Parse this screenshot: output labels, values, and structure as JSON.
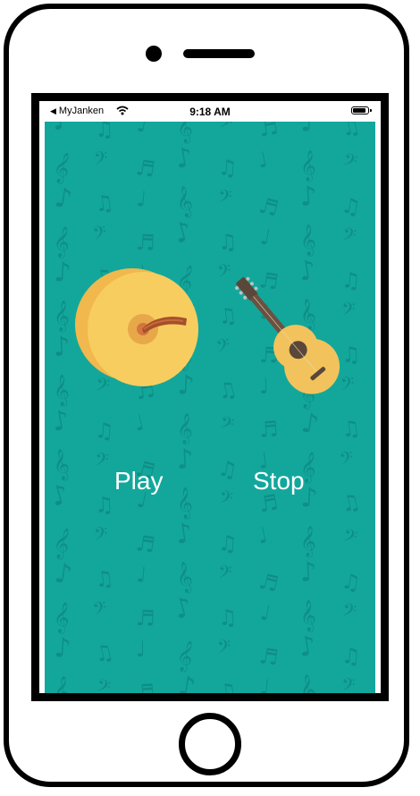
{
  "status_bar": {
    "back_app": "MyJanken",
    "time": "9:18 AM"
  },
  "instruments": {
    "left": "cymbal-icon",
    "right": "guitar-icon"
  },
  "controls": {
    "play_label": "Play",
    "stop_label": "Stop"
  },
  "colors": {
    "background": "#13a79c",
    "pattern": "#0e8f86",
    "cymbal": "#f8cd5f",
    "guitar_body": "#f2c35c",
    "guitar_neck": "#5b4739"
  }
}
